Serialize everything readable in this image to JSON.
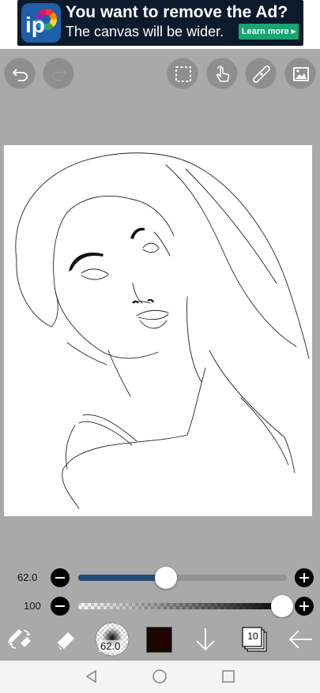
{
  "ad": {
    "title": "You want to remove the Ad?",
    "subtitle": "The canvas will be wider.",
    "cta": "Learn more",
    "logo_text": "ip"
  },
  "toolbar": {
    "icons": [
      "undo-icon",
      "redo-icon",
      "selection-icon",
      "hand-gesture-icon",
      "ruler-icon",
      "image-icon"
    ]
  },
  "brush_size": {
    "value_label": "62.0",
    "fraction": 0.42
  },
  "opacity": {
    "value_label": "100",
    "fraction": 1.0
  },
  "bottom": {
    "brush_preview_label": "62.0",
    "current_color": "#1a0404",
    "layer_count": "10"
  },
  "colors": {
    "background": "#a9a9a9",
    "canvas": "#ffffff",
    "size_track_fill": "#234a78",
    "ad_cta": "#18a572"
  }
}
